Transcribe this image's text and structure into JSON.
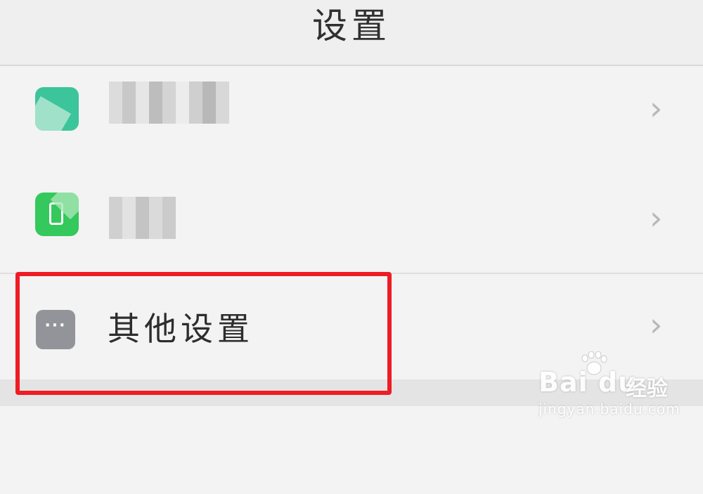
{
  "header": {
    "title": "设置"
  },
  "rows": [
    {
      "label_obscured": true,
      "icon": "app-green-teal-icon",
      "chevron": "›"
    },
    {
      "label_obscured": true,
      "icon": "phone-green-icon",
      "chevron": "›"
    },
    {
      "label": "其他设置",
      "icon": "more-dots-icon",
      "dots": "···",
      "chevron": "›",
      "highlighted": true
    }
  ],
  "highlight_color": "#ee1c24",
  "watermark": {
    "brand": "Bai du",
    "suffix": "经验",
    "url": "jingyan.baidu.com"
  }
}
